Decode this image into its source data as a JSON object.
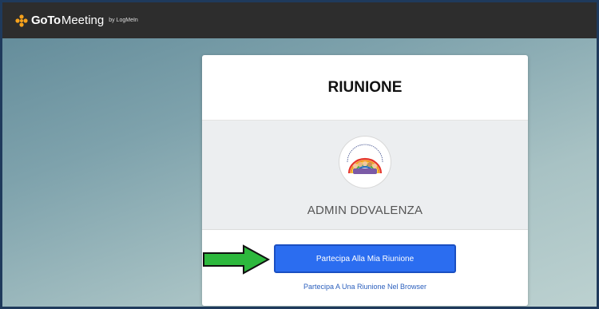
{
  "app": {
    "brand_go": "GoTo",
    "brand_meeting": "Meeting",
    "brand_by": "by LogMeIn"
  },
  "card": {
    "title": "RIUNIONE",
    "organizer_name": "ADMIN DDVALENZA",
    "join_button_label": "Partecipa Alla Mia Riunione",
    "browser_link_label": "Partecipa A Una Riunione Nel Browser"
  },
  "annotation": {
    "arrow_icon": "green-arrow-right-icon",
    "arrow_color": "#2db83d"
  },
  "colors": {
    "topbar": "#2d2d2d",
    "accent": "#2b6df0",
    "logo_orange": "#f7a21b"
  }
}
